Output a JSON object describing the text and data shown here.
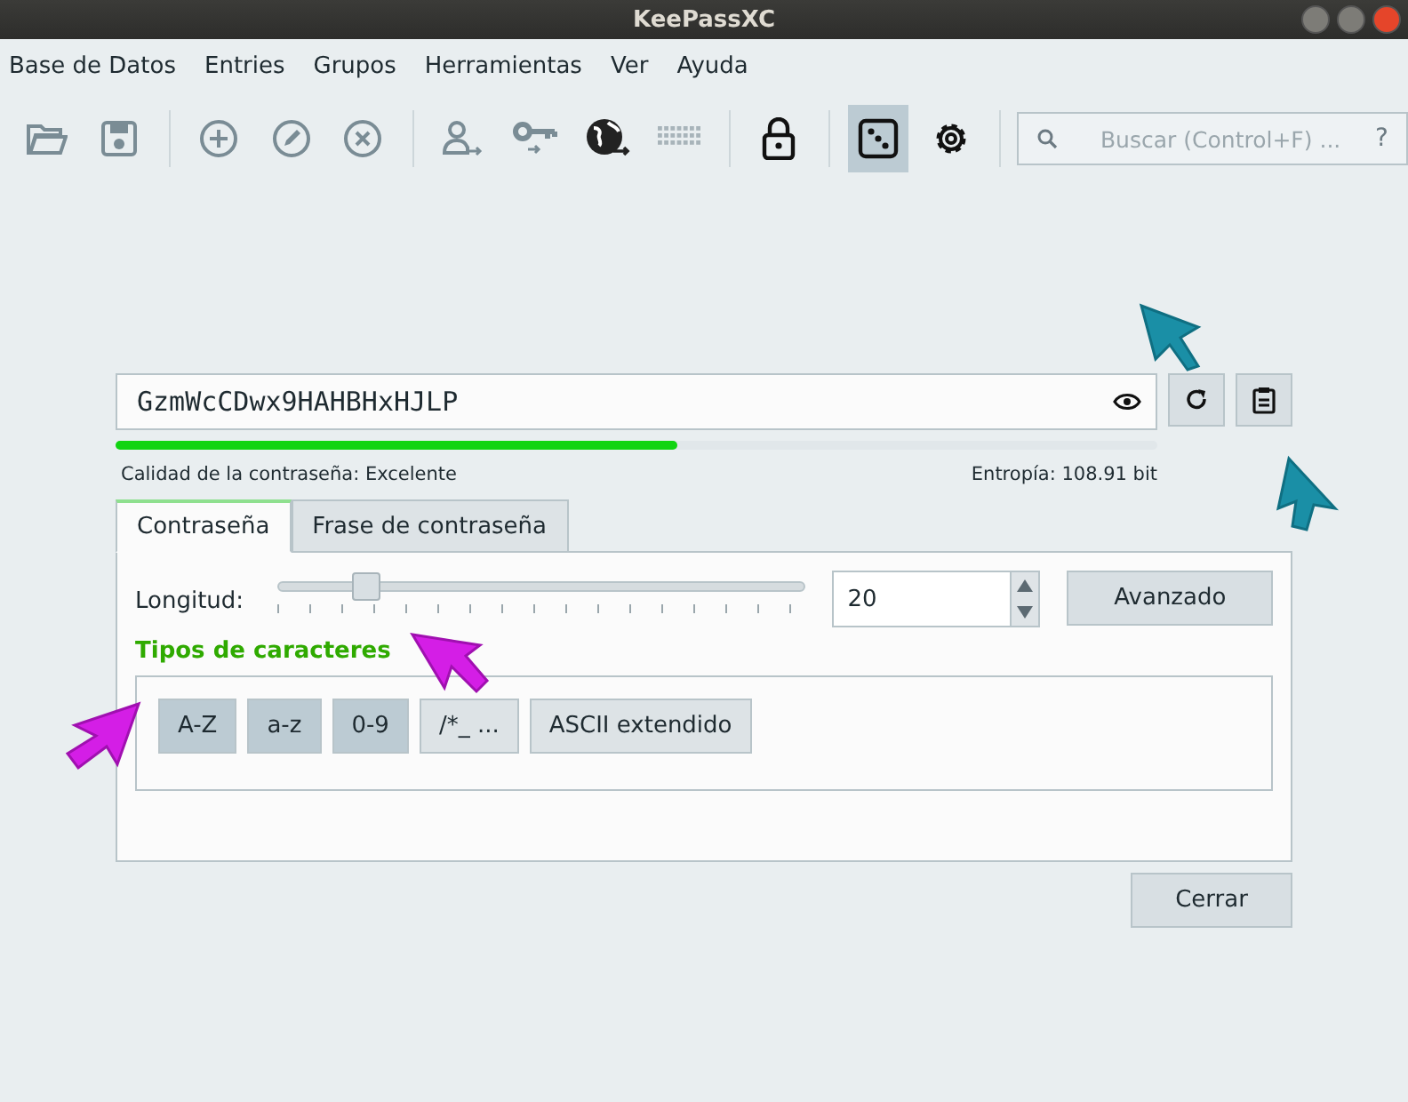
{
  "window": {
    "title": "KeePassXC"
  },
  "menu": [
    "Base de Datos",
    "Entries",
    "Grupos",
    "Herramientas",
    "Ver",
    "Ayuda"
  ],
  "toolbar": [
    {
      "kind": "folder",
      "selected": false
    },
    {
      "kind": "save",
      "selected": false
    },
    {
      "kind": "sep"
    },
    {
      "kind": "add",
      "selected": false
    },
    {
      "kind": "edit",
      "selected": false
    },
    {
      "kind": "delete",
      "selected": false
    },
    {
      "kind": "sep"
    },
    {
      "kind": "user",
      "selected": false
    },
    {
      "kind": "key",
      "selected": false
    },
    {
      "kind": "globe",
      "selected": false
    },
    {
      "kind": "keyboard",
      "selected": false
    },
    {
      "kind": "sep"
    },
    {
      "kind": "lock",
      "selected": false
    },
    {
      "kind": "sep"
    },
    {
      "kind": "dice",
      "selected": true
    },
    {
      "kind": "gear",
      "selected": false
    },
    {
      "kind": "sep"
    }
  ],
  "search": {
    "placeholder": "Buscar (Control+F) ...",
    "help": "?"
  },
  "password": {
    "value": "GzmWcCDwx9HAHBHxHJLP",
    "quality": {
      "level": 0.54
    },
    "quality_label": "Calidad de la contraseña: Excelente",
    "entropy": "Entropía: 108.91 bit"
  },
  "tabs": [
    {
      "label": "Contraseña",
      "selected": true
    },
    {
      "label": "Frase de contraseña",
      "selected": false
    }
  ],
  "length": {
    "label": "Longitud:",
    "level": 0.17,
    "value": "20"
  },
  "advanced_button": "Avanzado",
  "char_types": {
    "title": "Tipos de caracteres",
    "options": [
      {
        "label": "A-Z",
        "checked": true
      },
      {
        "label": "a-z",
        "checked": true
      },
      {
        "label": "0-9",
        "checked": true
      },
      {
        "label": "/*_ ...",
        "checked": false
      },
      {
        "label": "ASCII extendido",
        "checked": false
      }
    ]
  },
  "close_button": "Cerrar"
}
